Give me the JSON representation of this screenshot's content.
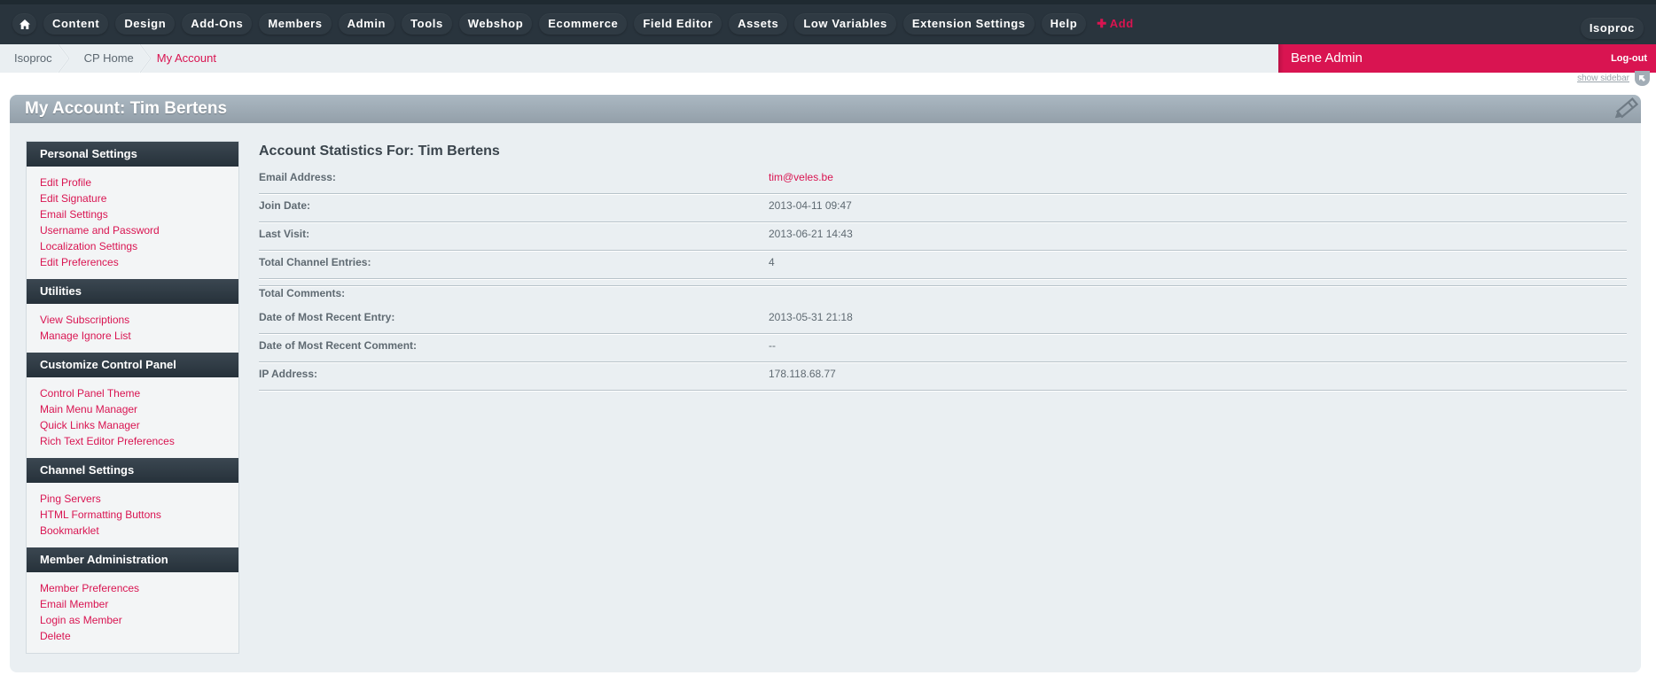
{
  "nav": {
    "home_icon": "home-icon",
    "items": [
      "Content",
      "Design",
      "Add-Ons",
      "Members",
      "Admin",
      "Tools",
      "Webshop",
      "Ecommerce",
      "Field Editor",
      "Assets",
      "Low Variables",
      "Extension Settings",
      "Help"
    ],
    "add_label": "Add",
    "add_icon": "plus-icon",
    "site_label": "Isoproc"
  },
  "breadcrumb": {
    "items": [
      "Isoproc",
      "CP Home"
    ],
    "current": "My Account"
  },
  "user": {
    "name": "Bene Admin",
    "logout_label": "Log-out"
  },
  "show_sidebar_label": "show sidebar",
  "page": {
    "title": "My Account: Tim Bertens",
    "icon": "pencil-icon"
  },
  "sidebar": {
    "sections": [
      {
        "title": "Personal Settings",
        "links": [
          "Edit Profile",
          "Edit Signature",
          "Email Settings",
          "Username and Password",
          "Localization Settings",
          "Edit Preferences"
        ]
      },
      {
        "title": "Utilities",
        "links": [
          "View Subscriptions",
          "Manage Ignore List"
        ]
      },
      {
        "title": "Customize Control Panel",
        "links": [
          "Control Panel Theme",
          "Main Menu Manager",
          "Quick Links Manager",
          "Rich Text Editor Preferences"
        ]
      },
      {
        "title": "Channel Settings",
        "links": [
          "Ping Servers",
          "HTML Formatting Buttons",
          "Bookmarklet"
        ]
      },
      {
        "title": "Member Administration",
        "links": [
          "Member Preferences",
          "Email Member",
          "Login as Member",
          "Delete"
        ]
      }
    ]
  },
  "stats": {
    "title": "Account Statistics For: Tim Bertens",
    "rows": [
      {
        "label": "Email Address:",
        "value": "tim@veles.be"
      },
      {
        "label": "Join Date:",
        "value": "2013-04-11 09:47"
      },
      {
        "label": "Last Visit:",
        "value": "2013-06-21 14:43"
      },
      {
        "label": "Total Channel Entries:",
        "value": "4"
      },
      {
        "label": "",
        "value": ""
      },
      {
        "label": "Total Comments:",
        "value": ""
      },
      {
        "label": "Date of Most Recent Entry:",
        "value": "2013-05-31 21:18"
      },
      {
        "label": "Date of Most Recent Comment:",
        "value": "--"
      },
      {
        "label": "IP Address:",
        "value": "178.118.68.77"
      }
    ]
  },
  "colors": {
    "accent": "#d91451",
    "nav_bg": "#29343d",
    "panel_bg": "#eaeff2",
    "panel_header": "#a2afb9",
    "sidebar_header": "#313c45"
  }
}
